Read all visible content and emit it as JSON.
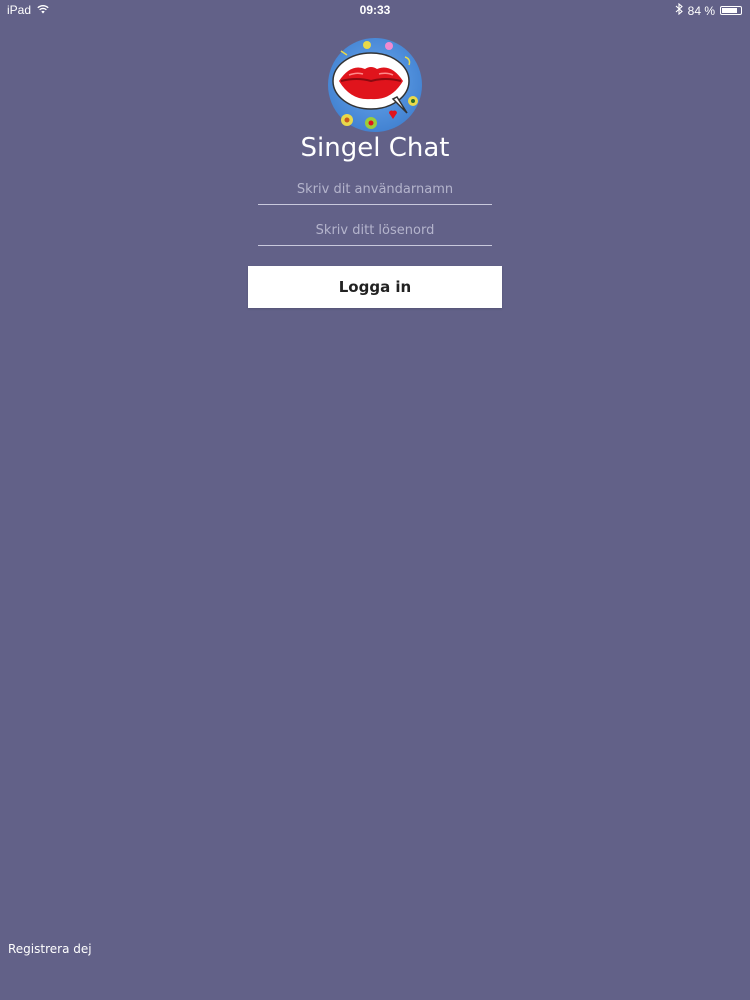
{
  "status_bar": {
    "device": "iPad",
    "time": "09:33",
    "battery_text": "84 %",
    "battery_level": 0.84,
    "icons": [
      "wifi-icon",
      "bluetooth-icon",
      "battery-icon"
    ]
  },
  "app": {
    "title": "Singel Chat",
    "logo": "lips-speech-bubble-logo"
  },
  "login": {
    "username_placeholder": "Skriv dit användarnamn",
    "username_value": "",
    "password_placeholder": "Skriv ditt lösenord",
    "password_value": "",
    "button_label": "Logga in"
  },
  "footer": {
    "register_label": "Registrera dej"
  },
  "colors": {
    "background": "#626188",
    "button": "#ffffff",
    "lips": "#e0141c",
    "logo_bg": "#4a8fd8"
  }
}
